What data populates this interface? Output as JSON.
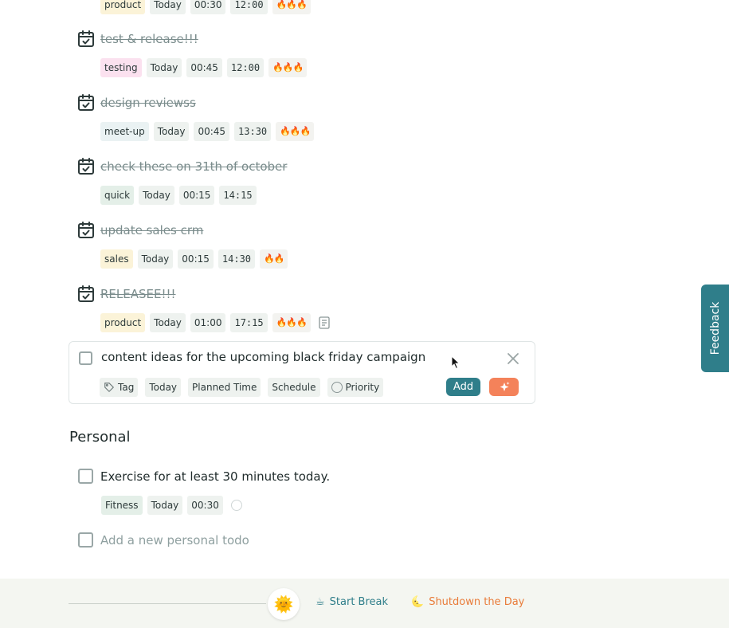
{
  "tasks": [
    {
      "title": "",
      "chips": [
        "product",
        "Today",
        "00:30",
        "12:00",
        "🔥🔥🔥"
      ]
    },
    {
      "title": "test & release!!!",
      "chips": [
        "testing",
        "Today",
        "00:45",
        "12:00",
        "🔥🔥🔥"
      ]
    },
    {
      "title": "design reviewss",
      "chips": [
        "meet-up",
        "Today",
        "00:45",
        "13:30",
        "🔥🔥🔥"
      ]
    },
    {
      "title": "check these on 31th of october",
      "chips": [
        "quick",
        "Today",
        "00:15",
        "14:15"
      ]
    },
    {
      "title": "update sales crm",
      "chips": [
        "sales",
        "Today",
        "00:15",
        "14:30",
        "🔥🔥"
      ]
    },
    {
      "title": "RELEASEE!!!",
      "chips": [
        "product",
        "Today",
        "01:00",
        "17:15",
        "🔥🔥🔥"
      ]
    }
  ],
  "editor": {
    "value": "content ideas for the upcoming black friday campaign",
    "tag_label": "Tag",
    "date_label": "Today",
    "planned_time_label": "Planned Time",
    "schedule_label": "Schedule",
    "priority_label": "Priority",
    "add_label": "Add"
  },
  "personal": {
    "title": "Personal",
    "todo": {
      "text": "Exercise for at least 30 minutes today.",
      "chips": [
        "Fitness",
        "Today",
        "00:30"
      ]
    },
    "new_placeholder": "Add a new personal todo"
  },
  "footer": {
    "sun_emoji": "🌞",
    "break_emoji": "☕",
    "break_label": "Start Break",
    "shutdown_emoji": "🌜",
    "shutdown_label": "Shutdown the Day"
  },
  "feedback_label": "Feedback",
  "colors": {
    "accent": "#2f7e8a",
    "ai_button": "#f4825a",
    "shutdown": "#e97c3a"
  }
}
